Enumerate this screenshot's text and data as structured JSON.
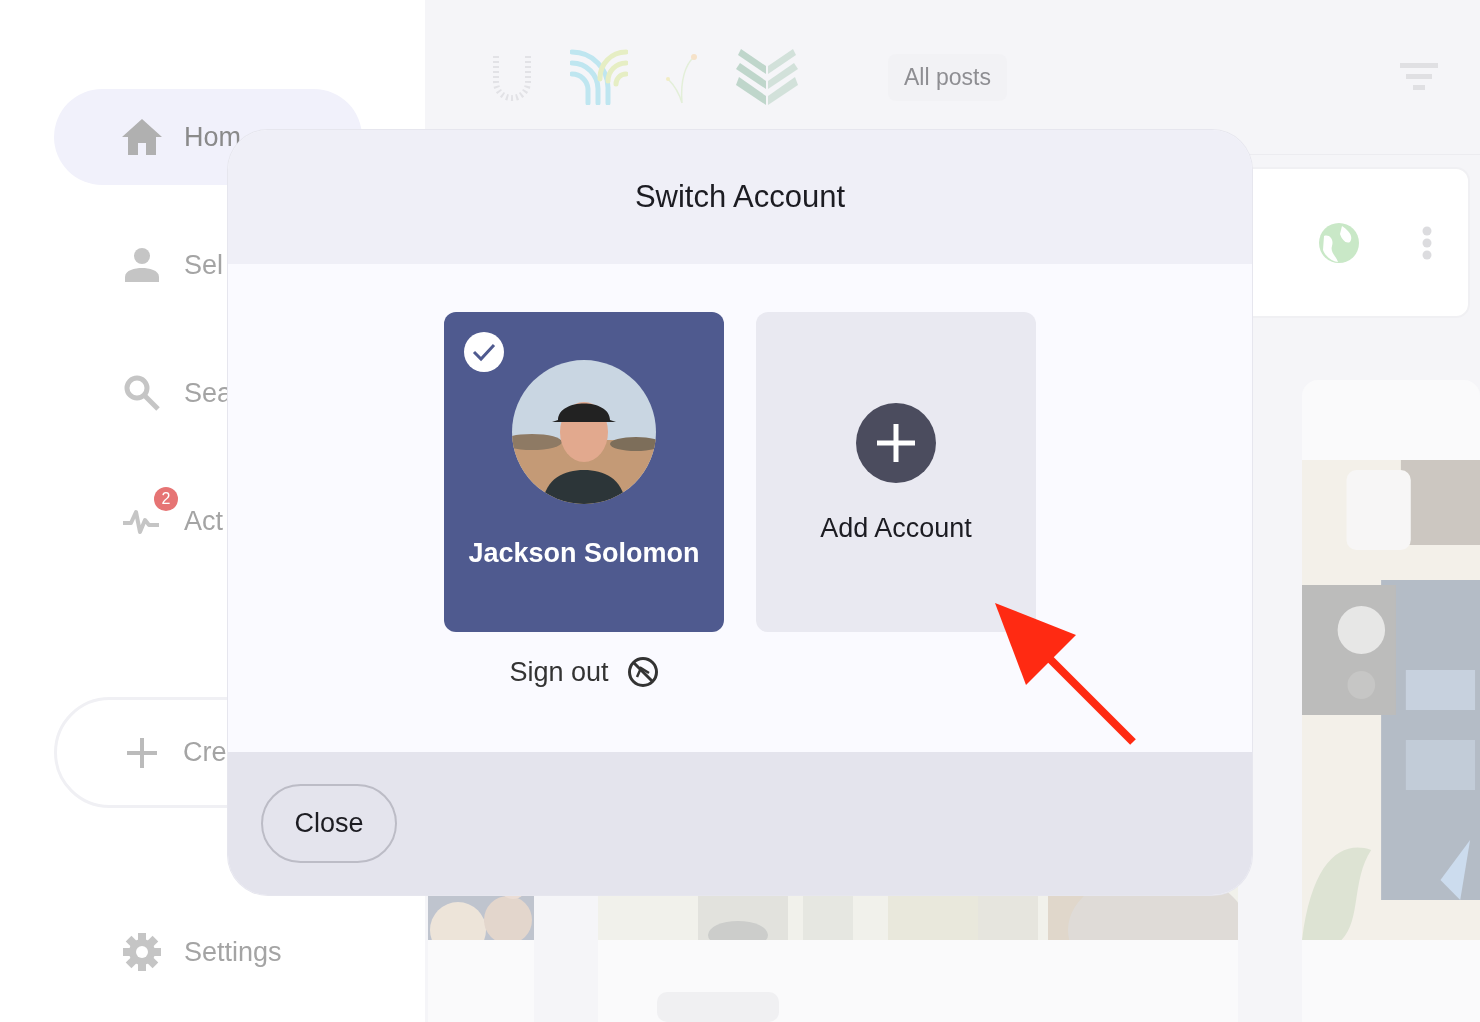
{
  "sidebar": {
    "items": [
      {
        "kind": "home",
        "label": "Hom",
        "selected": true
      },
      {
        "kind": "person",
        "label": "Sel",
        "selected": false
      },
      {
        "kind": "search",
        "label": "Sea",
        "selected": false
      },
      {
        "kind": "activity",
        "label": "Act",
        "selected": false,
        "badge": "2"
      }
    ],
    "create_button": "Cre",
    "settings": "Settings"
  },
  "feed": {
    "filter_chip": "All posts"
  },
  "dialog": {
    "title": "Switch Account",
    "accounts": [
      {
        "name": "Jackson Solomon",
        "selected": true
      }
    ],
    "add_account": "Add Account",
    "sign_out": "Sign out",
    "close": "Close"
  }
}
